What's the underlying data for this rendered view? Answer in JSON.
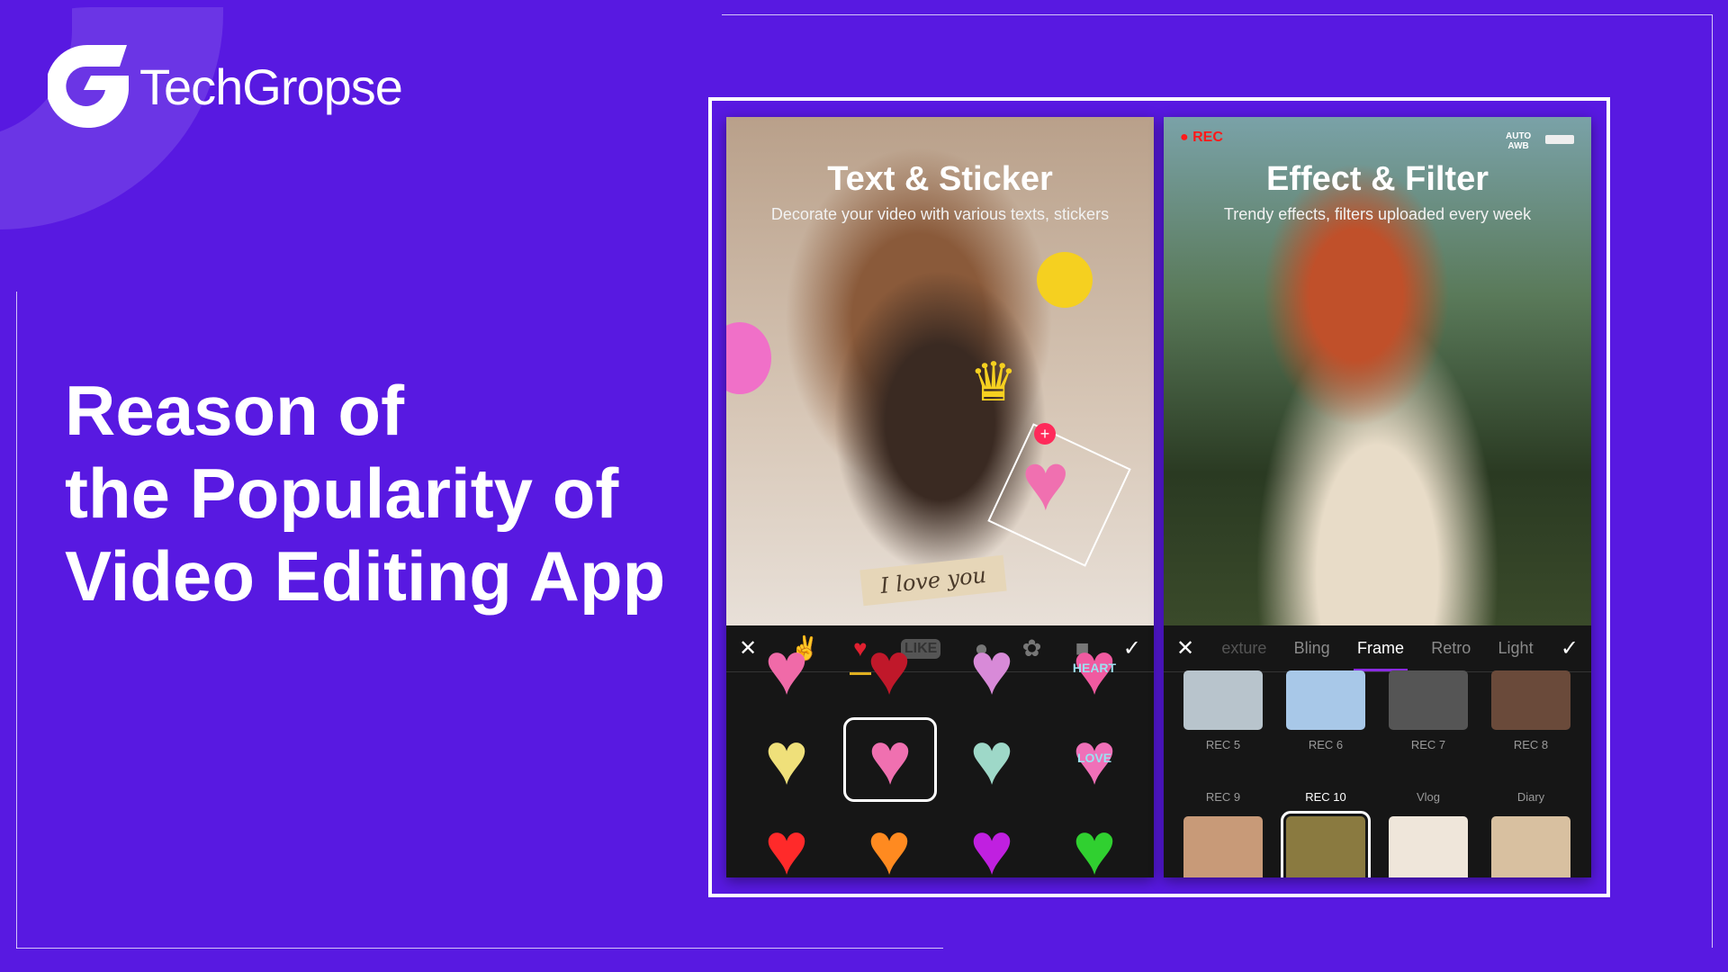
{
  "brand": {
    "name": "TechGropse"
  },
  "headline": [
    "Reason of",
    "the Popularity of",
    "Video Editing App"
  ],
  "colors": {
    "background": "#5819e1",
    "accent_frame_tab": "#8a2be2",
    "sticker_tab": "#e0b020",
    "rec": "#ff1a1a"
  },
  "left_phone": {
    "title": "Text & Sticker",
    "subtitle": "Decorate your video with various texts, stickers",
    "caption_sticker": "I love you",
    "toolbar": {
      "close": "✕",
      "confirm": "✓",
      "tabs": [
        {
          "icon": "rock-hand-icon"
        },
        {
          "icon": "heart-icon",
          "active": true
        },
        {
          "icon": "like-icon",
          "label": "LIKE"
        },
        {
          "icon": "bear-icon"
        },
        {
          "icon": "flower-icon"
        },
        {
          "icon": "toast-icon"
        }
      ]
    },
    "stickers": [
      {
        "color": "#f06aa8"
      },
      {
        "color": "#c0182a"
      },
      {
        "color": "#d88ad8"
      },
      {
        "color": "#f05aa0",
        "label": "HEART"
      },
      {
        "color": "#efe07a"
      },
      {
        "color": "#f070b0",
        "selected": true
      },
      {
        "color": "#9ed8c8"
      },
      {
        "color": "#f070b8",
        "label": "LOVE"
      },
      {
        "color": "#ff2a2a"
      },
      {
        "color": "#ff8a20"
      },
      {
        "color": "#c020e0"
      },
      {
        "color": "#30d030"
      }
    ]
  },
  "right_phone": {
    "title": "Effect & Filter",
    "subtitle": "Trendy effects, filters uploaded every week",
    "rec": "REC",
    "auto": "AUTO",
    "awb": "AWB",
    "toolbar": {
      "close": "✕",
      "confirm": "✓",
      "tabs": [
        {
          "label": "exture"
        },
        {
          "label": "Bling"
        },
        {
          "label": "Frame",
          "active": true
        },
        {
          "label": "Retro"
        },
        {
          "label": "Light"
        }
      ]
    },
    "frames": [
      {
        "label": "REC 5"
      },
      {
        "label": "REC 6"
      },
      {
        "label": "REC 7"
      },
      {
        "label": "REC 8"
      },
      {
        "label": "REC 9"
      },
      {
        "label": "REC 10",
        "selected": true
      },
      {
        "label": "Vlog"
      },
      {
        "label": "Diary"
      }
    ]
  }
}
